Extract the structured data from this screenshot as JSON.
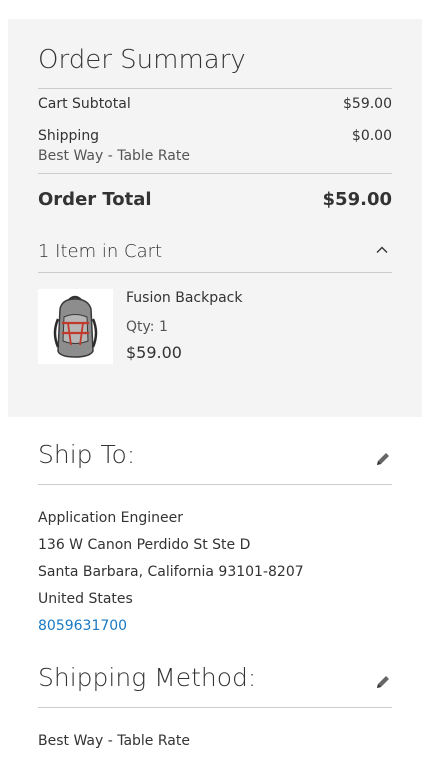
{
  "summary": {
    "title": "Order Summary",
    "subtotal_label": "Cart Subtotal",
    "subtotal_value": "$59.00",
    "shipping_label": "Shipping",
    "shipping_method": "Best Way - Table Rate",
    "shipping_value": "$0.00",
    "total_label": "Order Total",
    "total_value": "$59.00",
    "items_toggle_label": "1 Item in Cart",
    "item": {
      "name": "Fusion Backpack",
      "qty": "Qty: 1",
      "price": "$59.00"
    }
  },
  "ship_to": {
    "title": "Ship To:",
    "name": "Application Engineer",
    "street": "136 W Canon Perdido St Ste D",
    "city_line": "Santa Barbara, California 93101-8207",
    "country": "United States",
    "phone": "8059631700"
  },
  "shipping_method": {
    "title": "Shipping Method:",
    "value": "Best Way - Table Rate"
  },
  "colors": {
    "panel_bg": "#f4f4f4",
    "link": "#1979c3",
    "divider": "#cccccc"
  }
}
